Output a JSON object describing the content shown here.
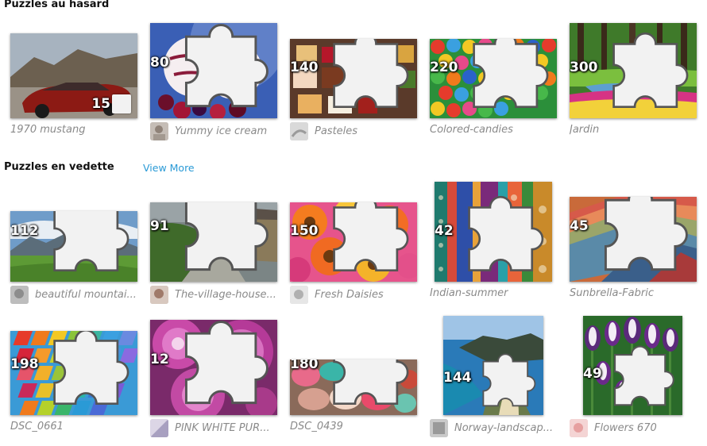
{
  "sections": {
    "random": {
      "title": "Puzzles au hasard"
    },
    "featured": {
      "title": "Puzzles en vedette",
      "view_more": "View More"
    }
  },
  "puzzles": [
    {
      "name": "1970 mustang",
      "pieces": "15",
      "icon": "square-icon",
      "avatar": false
    },
    {
      "name": "Yummy ice cream",
      "pieces": "80",
      "icon": "puzzle-piece-icon",
      "avatar": true
    },
    {
      "name": "Pasteles",
      "pieces": "140",
      "icon": "puzzle-piece-icon",
      "avatar": true
    },
    {
      "name": "Colored-candies",
      "pieces": "220",
      "icon": "puzzle-piece-icon",
      "avatar": false
    },
    {
      "name": "Jardin",
      "pieces": "300",
      "icon": "puzzle-piece-icon",
      "avatar": false
    },
    {
      "name": "beautiful mountai...",
      "pieces": "112",
      "icon": "puzzle-piece-icon",
      "avatar": true
    },
    {
      "name": "The-village-house...",
      "pieces": "91",
      "icon": "puzzle-piece-icon",
      "avatar": true
    },
    {
      "name": "Fresh Daisies",
      "pieces": "150",
      "icon": "puzzle-piece-icon",
      "avatar": true
    },
    {
      "name": "Indian-summer",
      "pieces": "42",
      "icon": "puzzle-piece-icon",
      "avatar": false
    },
    {
      "name": "Sunbrella-Fabric",
      "pieces": "45",
      "icon": "puzzle-piece-icon",
      "avatar": false
    },
    {
      "name": "DSC_0661",
      "pieces": "198",
      "icon": "puzzle-piece-icon",
      "avatar": false
    },
    {
      "name": "PINK WHITE PUR...",
      "pieces": "12",
      "icon": "puzzle-piece-icon",
      "avatar": true
    },
    {
      "name": "DSC_0439",
      "pieces": "180",
      "icon": "puzzle-piece-icon",
      "avatar": false
    },
    {
      "name": "Norway-landscap...",
      "pieces": "144",
      "icon": "puzzle-piece-icon",
      "avatar": true
    },
    {
      "name": "Flowers 670",
      "pieces": "49",
      "icon": "puzzle-piece-icon",
      "avatar": true
    }
  ],
  "colors": {
    "link": "#2a9ad6",
    "caption": "#8a8a8a",
    "heading": "#111111"
  }
}
